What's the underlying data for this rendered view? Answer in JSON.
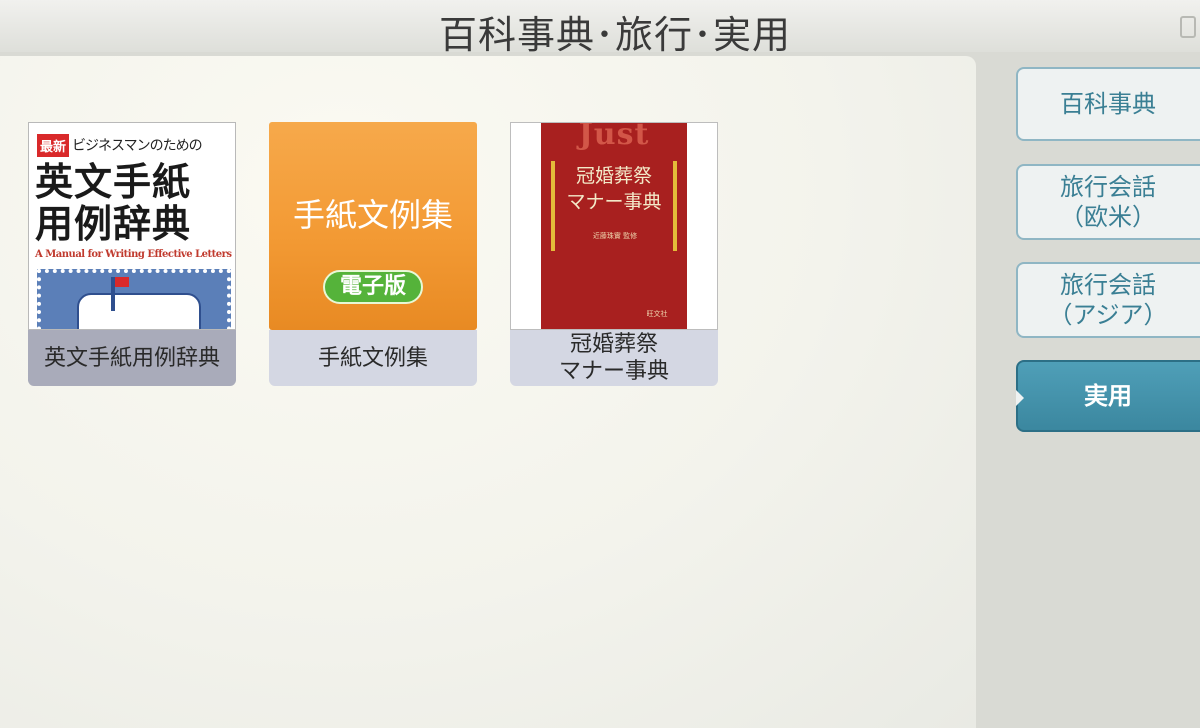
{
  "header": {
    "title": "百科事典･旅行･実用"
  },
  "books": [
    {
      "caption": "英文手紙用例辞典",
      "selected": true,
      "cover": {
        "badge": "最新",
        "tagline": "ビジネスマンのための",
        "title": "英文手紙\n用例辞典",
        "english": "A Manual for Writing Effective Letters"
      }
    },
    {
      "caption": "手紙文例集",
      "selected": false,
      "cover": {
        "title": "手紙文例集",
        "badge": "電子版"
      }
    },
    {
      "caption": "冠婚葬祭\nマナー事典",
      "selected": false,
      "cover": {
        "brand": "Just",
        "title": "冠婚葬祭\nマナー事典",
        "editor": "近藤珠實 監修",
        "publisher": "旺文社"
      }
    }
  ],
  "tabs": [
    {
      "label": "百科事典",
      "active": false
    },
    {
      "label": "旅行会話\n（欧米）",
      "active": false
    },
    {
      "label": "旅行会話\n（アジア）",
      "active": false
    },
    {
      "label": "実用",
      "active": true
    }
  ],
  "colors": {
    "tab_active": "#3f8ca6",
    "tab_text": "#3a7f94",
    "caption_bg": "#d4d7e3",
    "cover_orange": "#f39a34",
    "cover_red": "#a8201f"
  }
}
